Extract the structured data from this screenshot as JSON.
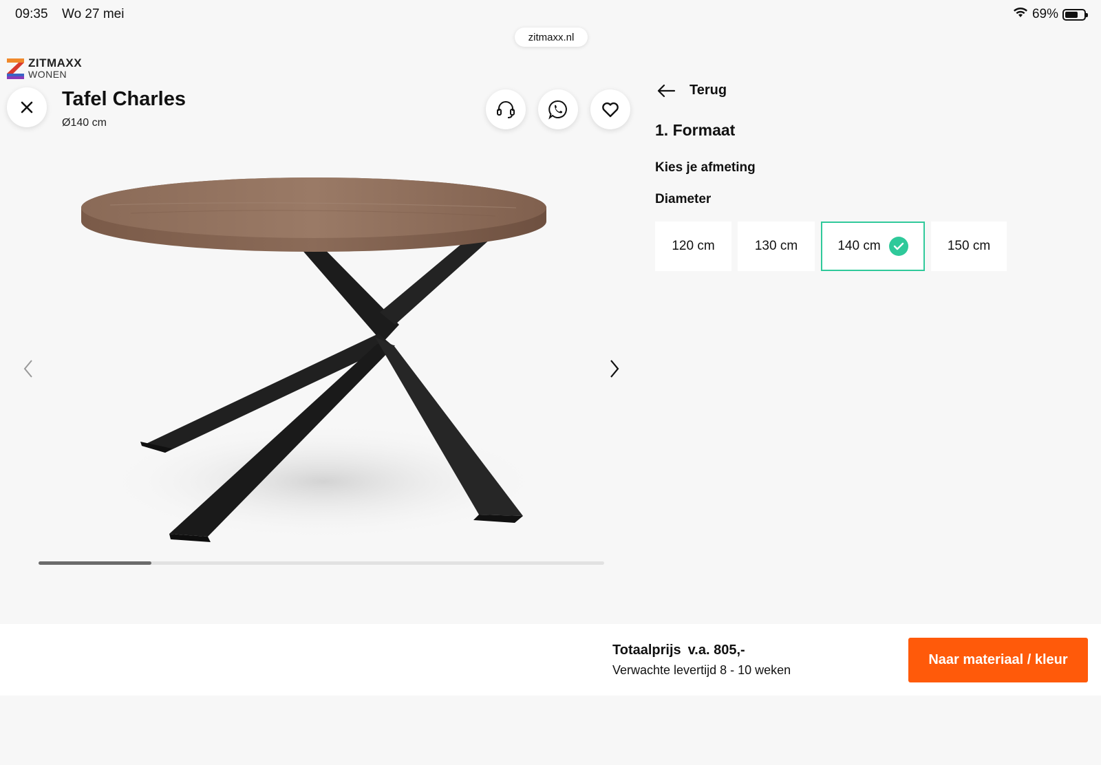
{
  "status_bar": {
    "time": "09:35",
    "date": "Wo 27 mei",
    "battery": "69%",
    "battery_level": 0.69,
    "wifi_icon": "wifi-icon"
  },
  "browser": {
    "url": "zitmaxx.nl"
  },
  "logo": {
    "name": "ZITMAXX",
    "sub": "WONEN"
  },
  "product": {
    "title": "Tafel Charles",
    "subtitle": "Ø140 cm",
    "gallery_position": 0.2
  },
  "icons": {
    "close": "close-icon",
    "support": "headset-icon",
    "whatsapp": "whatsapp-icon",
    "favorite": "heart-icon",
    "prev": "chevron-left-icon",
    "next": "chevron-right-icon",
    "back": "arrow-left-icon",
    "check": "check-icon"
  },
  "configurator": {
    "back_label": "Terug",
    "step_title": "1. Formaat",
    "section_title": "Kies je afmeting",
    "field_label": "Diameter",
    "options": [
      {
        "label": "120 cm",
        "selected": false
      },
      {
        "label": "130 cm",
        "selected": false
      },
      {
        "label": "140 cm",
        "selected": true
      },
      {
        "label": "150 cm",
        "selected": false
      }
    ]
  },
  "footer": {
    "price_label": "Totaalprijs",
    "price_value": "v.a. 805,-",
    "delivery": "Verwachte levertijd 8 - 10 weken",
    "cta": "Naar materiaal / kleur"
  },
  "colors": {
    "accent": "#ff5a0a",
    "selected_border": "#2fc99a",
    "background": "#f7f7f7"
  }
}
